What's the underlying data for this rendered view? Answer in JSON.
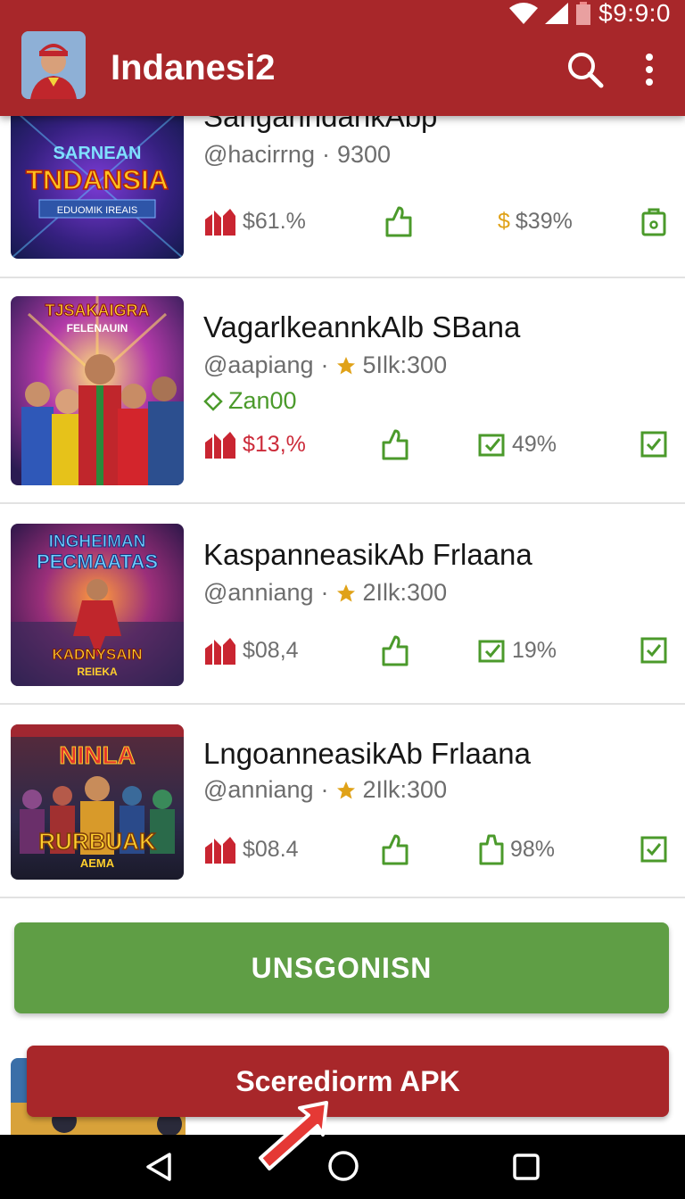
{
  "status": {
    "time": "$9:9:0"
  },
  "appbar": {
    "title": "Indanesi2"
  },
  "items": [
    {
      "title": "SanganndankAbp",
      "handle": "@hacirrng",
      "meta": "9300",
      "tag": "",
      "stat1": "$61.%",
      "stat2": "$39%",
      "stat3": ""
    },
    {
      "title": "VagarlkeannkAlb SBana",
      "handle": "@aapiang",
      "meta": "5Ilk:300",
      "tag": "Zan00",
      "stat1": "$13,%",
      "stat2": "49%",
      "stat3": ""
    },
    {
      "title": "KaspanneasikAb Frlaana",
      "handle": "@anniang",
      "meta": "2Ilk:300",
      "tag": "",
      "stat1": "$08,4",
      "stat2": "19%",
      "stat3": ""
    },
    {
      "title": "LngoanneasikAb Frlaana",
      "handle": "@anniang",
      "meta": "2Ilk:300",
      "tag": "",
      "stat1": "$08.4",
      "stat2": "98%",
      "stat3": ""
    }
  ],
  "thumbs": [
    {
      "line1": "SARNEAN",
      "line2": "TNDANSIA",
      "line3": "EDUOMIK IREAIS"
    },
    {
      "line1": "TJSAKAIGRA",
      "line2": "FELENAUIN"
    },
    {
      "line1": "INGHEIMAN",
      "line2": "PECMAATAS",
      "line3": "KADNYSAIN",
      "line4": "REIEKA"
    },
    {
      "line1": "NINLA",
      "line2": "RURBUAK",
      "line3": "AEMA"
    }
  ],
  "buttons": {
    "primary": "UNSGONISN",
    "secondary": "Scerediorm APK"
  },
  "colors": {
    "appbar": "#a8272a",
    "primary_button": "#5f9e45",
    "accent_green": "#4b9a2b",
    "accent_red": "#cc2b3a",
    "accent_gold": "#e0a218"
  },
  "icons": [
    "search-icon",
    "more-vert-icon",
    "thumbs-up-icon",
    "bag-icon",
    "check-square-icon",
    "star-icon",
    "tag-icon",
    "nav-back-icon",
    "nav-home-icon",
    "nav-recent-icon"
  ]
}
